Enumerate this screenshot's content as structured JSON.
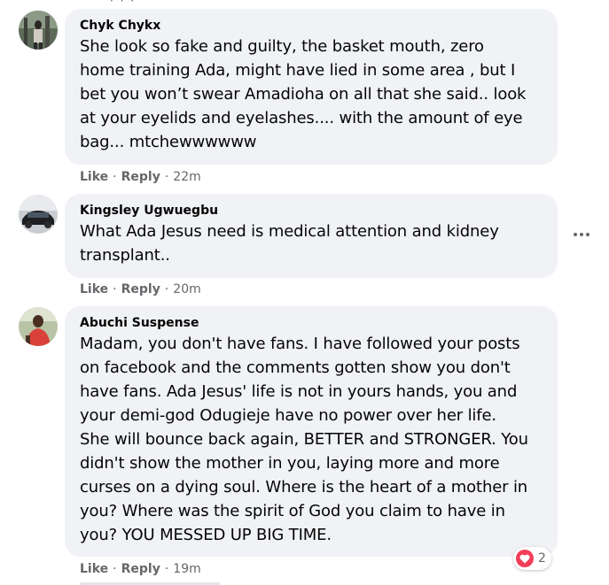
{
  "top": {
    "fragment": "· · ·"
  },
  "comments": [
    {
      "author": "Chyk Chykx",
      "lines": [
        "She look so fake and guilty, the basket mouth, zero",
        "home training Ada, might have lied in some area , but I",
        "bet you won’t swear Amadioha on all that she said.. look",
        "at your eyelids and eyelashes.... with the amount of eye",
        "bag... mtchewwwwww"
      ],
      "like": "Like",
      "reply": "Reply",
      "time": "22m"
    },
    {
      "author": "Kingsley Ugwuegbu",
      "lines": [
        "What Ada Jesus need is medical attention and kidney",
        "transplant.."
      ],
      "like": "Like",
      "reply": "Reply",
      "time": "20m"
    },
    {
      "author": "Abuchi Suspense",
      "lines": [
        "Madam, you don't have fans. I have followed your posts",
        "on facebook and the comments gotten show you don't",
        "have fans. Ada Jesus' life is not in yours hands, you and",
        "your demi-god Odugieje have no power over her life.",
        "She will bounce back again, BETTER and STRONGER. You",
        "didn't show the mother in you, laying more and more",
        "curses on a dying soul. Where is the heart of a mother in",
        "you? Where was the spirit of God you claim to have in",
        "you? YOU MESSED UP BIG TIME."
      ],
      "like": "Like",
      "reply": "Reply",
      "time": "19m",
      "reaction_count": "2"
    }
  ],
  "colors": {
    "bubble": "#f0f2f5",
    "meta": "#65676b",
    "heart": "#f33e58"
  }
}
